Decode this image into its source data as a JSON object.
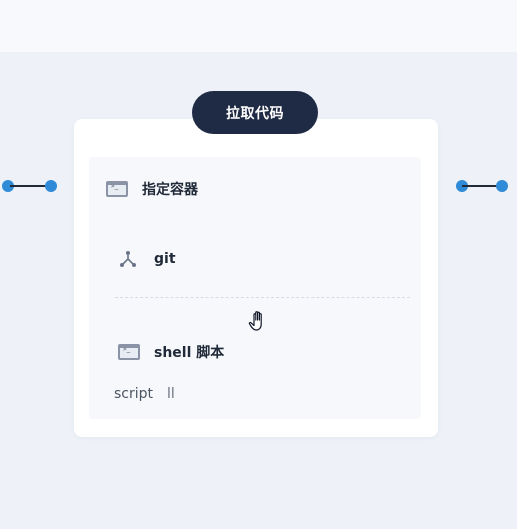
{
  "stage": {
    "title": "拉取代码"
  },
  "steps": {
    "container": {
      "label": "指定容器",
      "icon": "terminal-icon"
    },
    "git": {
      "label": "git",
      "icon": "git-icon"
    },
    "shell": {
      "label": "shell 脚本",
      "icon": "terminal-icon"
    }
  },
  "script": {
    "label": "script",
    "value": "ll"
  },
  "colors": {
    "pill": "#1f2a44",
    "connector_dot": "#2f8ad8",
    "background": "#eef2f8"
  }
}
